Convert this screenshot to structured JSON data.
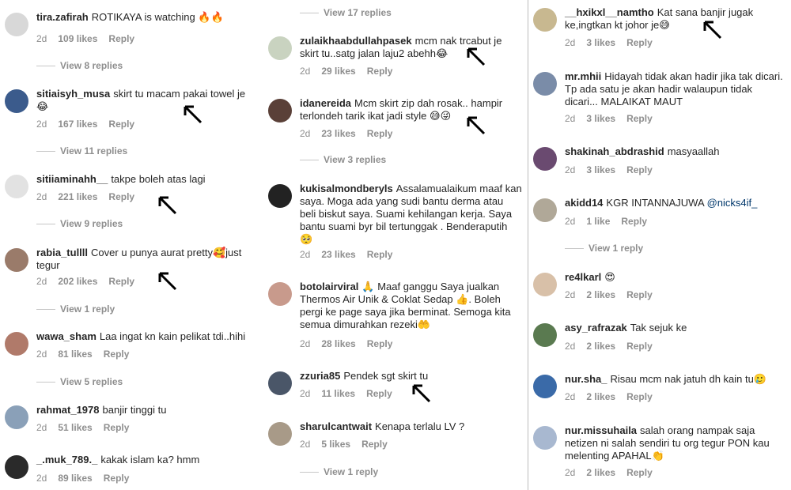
{
  "columns": [
    {
      "comments": [
        {
          "username": "tira.zafirah",
          "text": "ROTIKAYA is watching 🔥🔥",
          "age": "2d",
          "likes": "109 likes",
          "reply": "Reply",
          "replies": "View 8 replies",
          "avatar_color": "#d8d8d8"
        },
        {
          "username": "sitiaisyh_musa",
          "text": "skirt tu macam pakai towel je 😂",
          "age": "2d",
          "likes": "167 likes",
          "reply": "Reply",
          "replies": "View 11 replies",
          "avatar_color": "#3b5b8c"
        },
        {
          "username": "sitiiaminahh__",
          "text": "takpe boleh atas lagi",
          "age": "2d",
          "likes": "221 likes",
          "reply": "Reply",
          "replies": "View 9 replies",
          "avatar_color": "#e2e2e2"
        },
        {
          "username": "rabia_tullll",
          "text": "Cover u punya aurat pretty🥰just tegur",
          "age": "2d",
          "likes": "202 likes",
          "reply": "Reply",
          "replies": "View 1 reply",
          "avatar_color": "#9a7b6a"
        },
        {
          "username": "wawa_sham",
          "text": "Laa ingat kn kain pelikat tdi..hihi",
          "age": "2d",
          "likes": "81 likes",
          "reply": "Reply",
          "replies": "View 5 replies",
          "avatar_color": "#b07a6a"
        },
        {
          "username": "rahmat_1978",
          "text": "banjir tinggi tu",
          "age": "2d",
          "likes": "51 likes",
          "reply": "Reply",
          "replies": "",
          "avatar_color": "#8aa0b8"
        },
        {
          "username": "_.muk_789._",
          "text": "kakak islam ka? hmm",
          "age": "2d",
          "likes": "89 likes",
          "reply": "Reply",
          "replies": "",
          "avatar_color": "#2a2a2a"
        }
      ]
    },
    {
      "top_replies": "View 17 replies",
      "comments": [
        {
          "username": "zulaikhaabdullahpasek",
          "text": "mcm nak trcabut je skirt tu..satg jalan laju2 abehh😂",
          "age": "2d",
          "likes": "29 likes",
          "reply": "Reply",
          "replies": "",
          "avatar_color": "#c9d3c0"
        },
        {
          "username": "idanereida",
          "text": "Mcm skirt zip dah rosak.. hampir terlondeh tarik ikat jadi style 😅😜",
          "age": "2d",
          "likes": "23 likes",
          "reply": "Reply",
          "replies": "View 3 replies",
          "avatar_color": "#5a4038"
        },
        {
          "username": "kukisalmondberyls",
          "text": "Assalamualaikum maaf kan saya. Moga ada yang sudi bantu derma atau beli biskut saya. Suami kehilangan kerja. Saya bantu suami byr bil tertunggak . Benderaputih 🥺",
          "age": "2d",
          "likes": "23 likes",
          "reply": "Reply",
          "replies": "",
          "avatar_color": "#222222"
        },
        {
          "username": "botolairviral",
          "text": "🙏 Maaf ganggu Saya jualkan Thermos Air Unik & Coklat Sedap 👍. Boleh pergi ke page saya jika berminat. Semoga kita semua dimurahkan rezeki🤲",
          "age": "2d",
          "likes": "28 likes",
          "reply": "Reply",
          "replies": "",
          "avatar_color": "#c89a8c"
        },
        {
          "username": "zzuria85",
          "text": "Pendek sgt skirt tu",
          "age": "2d",
          "likes": "11 likes",
          "reply": "Reply",
          "replies": "",
          "avatar_color": "#4a5668"
        },
        {
          "username": "sharulcantwait",
          "text": "Kenapa terlalu LV ?",
          "age": "2d",
          "likes": "5 likes",
          "reply": "Reply",
          "replies": "View 1 reply",
          "avatar_color": "#a89a88"
        }
      ]
    },
    {
      "comments": [
        {
          "username": "__hxikxl__namtho",
          "text": "Kat sana banjir jugak ke,ingtkan kt johor je😅",
          "age": "2d",
          "likes": "3 likes",
          "reply": "Reply",
          "replies": "",
          "avatar_color": "#c8b890"
        },
        {
          "username": "mr.mhii",
          "text": "Hidayah tidak akan hadir jika tak dicari. Tp ada satu je akan hadir walaupun tidak dicari... MALAIKAT MAUT",
          "age": "2d",
          "likes": "3 likes",
          "reply": "Reply",
          "replies": "",
          "avatar_color": "#7a8ca8"
        },
        {
          "username": "shakinah_abdrashid",
          "text": "masyaallah",
          "age": "2d",
          "likes": "3 likes",
          "reply": "Reply",
          "replies": "",
          "avatar_color": "#6a4a70"
        },
        {
          "username": "akidd14",
          "text": "KGR INTANNAJUWA",
          "mention": "@nicks4if_",
          "age": "2d",
          "likes": "1 like",
          "reply": "Reply",
          "replies": "View 1 reply",
          "avatar_color": "#b0a898"
        },
        {
          "username": "re4lkarl",
          "text": "😍",
          "age": "2d",
          "likes": "2 likes",
          "reply": "Reply",
          "replies": "",
          "avatar_color": "#d8c0a8"
        },
        {
          "username": "asy_rafrazak",
          "text": "Tak sejuk ke",
          "age": "2d",
          "likes": "2 likes",
          "reply": "Reply",
          "replies": "",
          "avatar_color": "#5a7a50"
        },
        {
          "username": "nur.sha_",
          "text": "Risau mcm nak jatuh dh kain tu🥲",
          "age": "2d",
          "likes": "2 likes",
          "reply": "Reply",
          "replies": "",
          "avatar_color": "#3a6aa8"
        },
        {
          "username": "nur.missuhaila",
          "text": "salah orang nampak saja netizen ni salah sendiri tu org tegur PON kau melenting APAHAL👏",
          "age": "2d",
          "likes": "2 likes",
          "reply": "Reply",
          "replies": "",
          "avatar_color": "#a8b8d0"
        }
      ]
    }
  ],
  "arrow_icon": "arrow-cursor-icon"
}
